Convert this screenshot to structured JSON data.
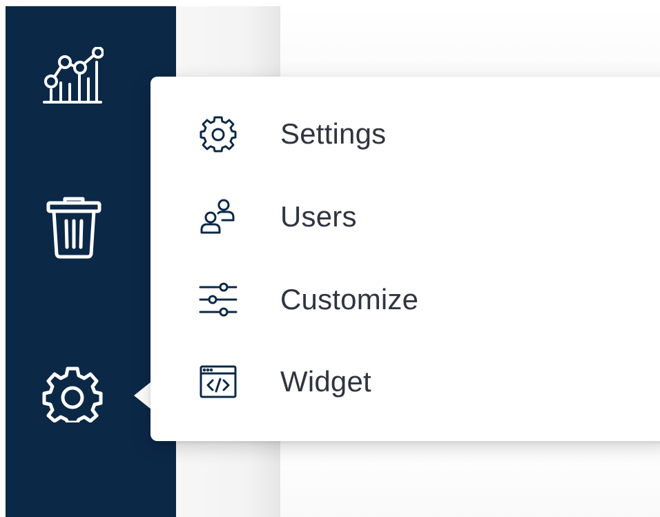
{
  "sidebar": {
    "background": "#0b2847",
    "icons": [
      {
        "name": "analytics-icon"
      },
      {
        "name": "trash-icon"
      },
      {
        "name": "gear-icon"
      }
    ]
  },
  "menu": {
    "items": [
      {
        "label": "Settings",
        "icon": "gear-icon"
      },
      {
        "label": "Users",
        "icon": "users-icon"
      },
      {
        "label": "Customize",
        "icon": "sliders-icon"
      },
      {
        "label": "Widget",
        "icon": "code-window-icon"
      }
    ],
    "text_color": "#2f3540",
    "icon_color": "#0b2847"
  }
}
